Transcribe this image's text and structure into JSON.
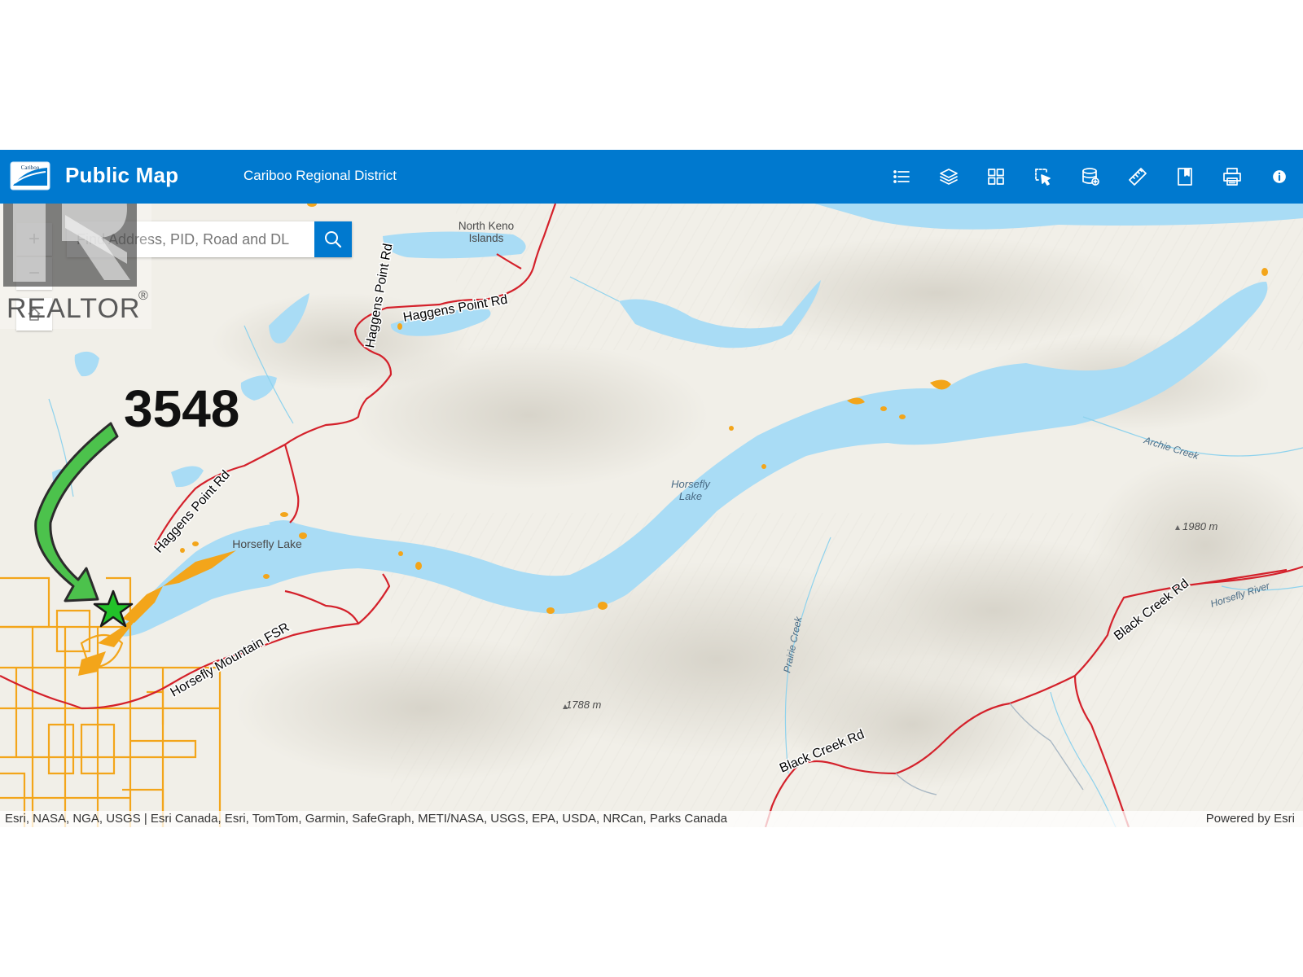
{
  "header": {
    "app_title": "Public Map",
    "org_name": "Cariboo Regional District",
    "logo_text": "Cariboo",
    "brand_color": "#0079cf"
  },
  "toolbar": {
    "tools": [
      "list-icon",
      "layers-icon",
      "basemap-grid-icon",
      "select-icon",
      "database-icon",
      "measure-ruler-icon",
      "bookmark-icon",
      "print-icon",
      "info-icon"
    ]
  },
  "map_controls": {
    "zoom_in": "+",
    "zoom_out": "−",
    "home": "home-icon"
  },
  "search": {
    "placeholder": "Find Address, PID, Road and DL"
  },
  "watermark": {
    "text": "REALTOR",
    "mark": "®"
  },
  "annotation": {
    "listing_number": "3548",
    "marker": "green-star",
    "arrow_color": "#4cc24c"
  },
  "map_labels": {
    "north_keno_1": "North Keno",
    "north_keno_2": "Islands",
    "haggens_point_rd_1": "Haggens Point Rd",
    "haggens_point_rd_2": "Haggens Point Rd",
    "horsefly_lake_main": "Horsefly Lake",
    "horsefly_lake_1": "Horsefly",
    "horsefly_lake_2": "Lake",
    "archie_creek": "Archie Creek",
    "elev_1980": "1980 m",
    "horsefly_river": "Horsefly River",
    "black_creek_rd_1": "Black Creek Rd",
    "black_creek_rd_2": "Black Creek Rd",
    "prairie_creek": "Prairie Creek",
    "elev_1788": "1788 m",
    "horsefly_mountain_fsr": "Horsefly Mountain FSR"
  },
  "attribution": {
    "sources": "Esri, NASA, NGA, USGS | Esri Canada, Esri, TomTom, Garmin, SafeGraph, METI/NASA, USGS, EPA, USDA, NRCan, Parks Canada",
    "powered_by": "Powered by Esri"
  },
  "colors": {
    "water": "#a9dcf5",
    "road": "#d4212b",
    "parcel": "#f3a51a",
    "terrain": "#f1efe8"
  }
}
